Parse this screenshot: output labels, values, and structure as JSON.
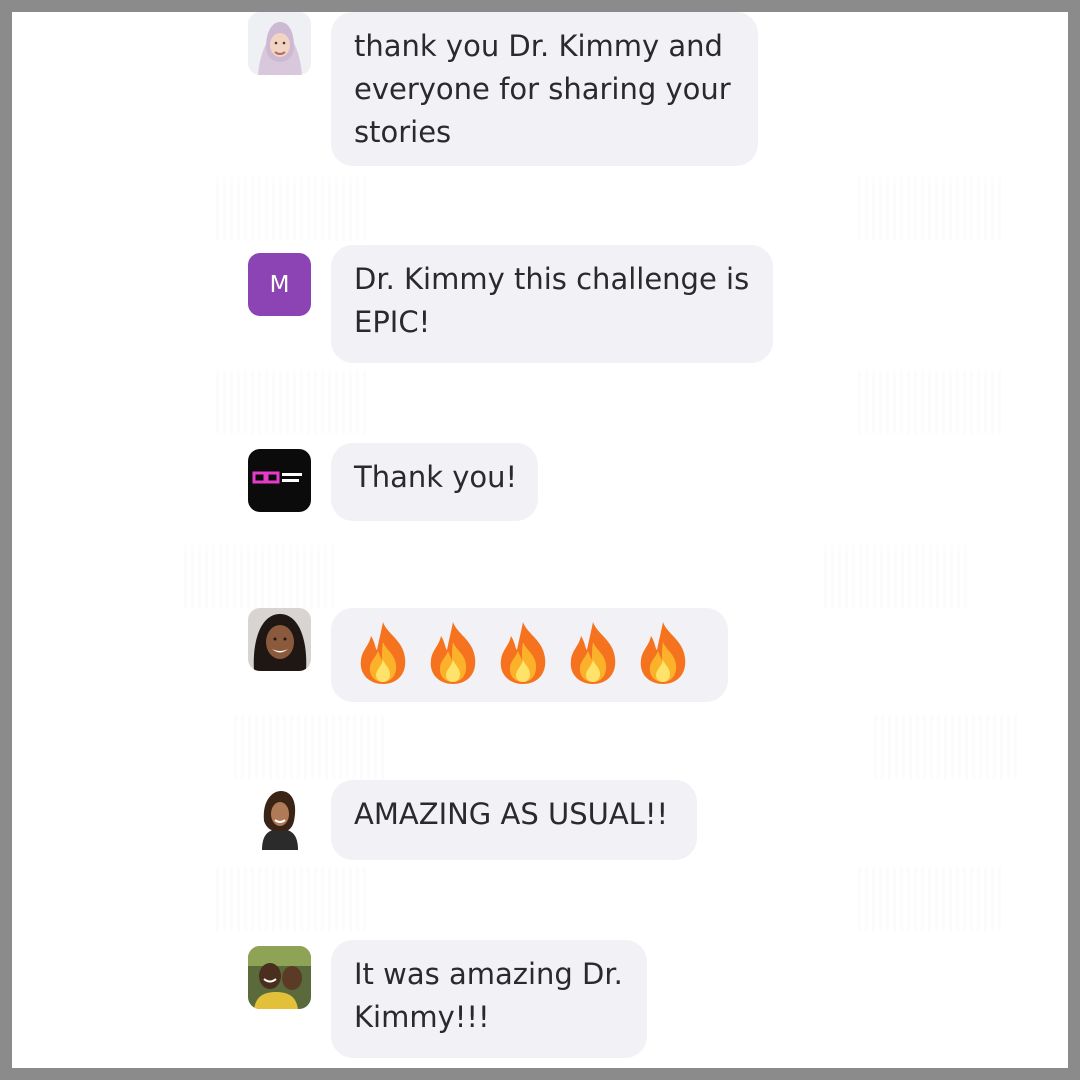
{
  "messages": [
    {
      "avatar": "woman-hijab-photo",
      "text_lines": [
        "thank you Dr. Kimmy and",
        "everyone for sharing your",
        "stories"
      ]
    },
    {
      "avatar_letter": "M",
      "avatar_color": "#8c44b4",
      "text_lines": [
        "Dr. Kimmy this challenge is",
        "EPIC!"
      ]
    },
    {
      "avatar": "capital-dynasty-logo",
      "text_lines": [
        "Thank you!"
      ]
    },
    {
      "avatar": "woman-smiling-photo",
      "emoji": [
        "🔥",
        "🔥",
        "🔥",
        "🔥",
        "🔥"
      ]
    },
    {
      "avatar": "woman-portrait-photo",
      "text_lines": [
        "AMAZING AS USUAL!!"
      ]
    },
    {
      "avatar": "group-selfie-photo",
      "text_lines": [
        "It was amazing Dr.",
        "Kimmy!!!"
      ]
    }
  ],
  "colors": {
    "bubble": "#f1f1f6",
    "text": "#2a2a2e",
    "frame": "#8a8b8a"
  }
}
